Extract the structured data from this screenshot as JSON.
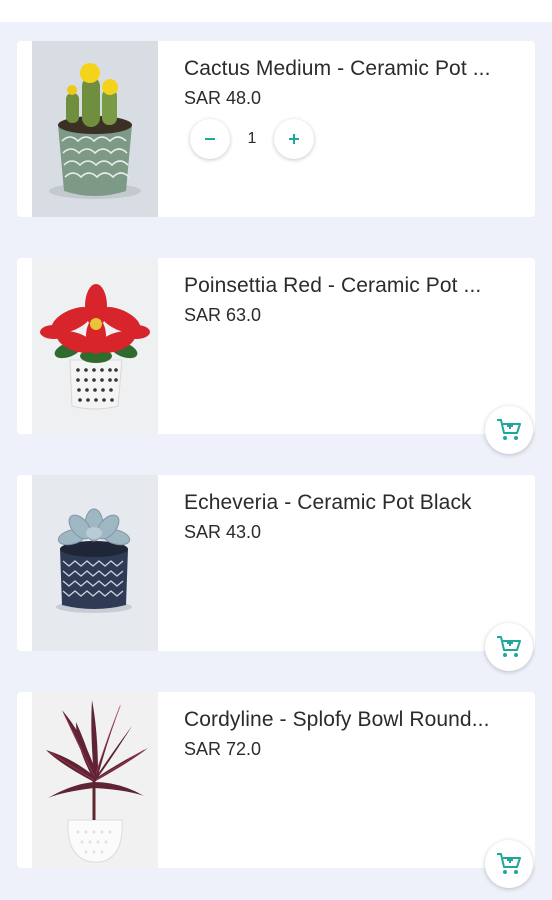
{
  "colors": {
    "background": "#eef1fa",
    "card": "#ffffff",
    "accent": "#1fa89a",
    "text": "#2b2b2b"
  },
  "products": [
    {
      "name": "Cactus Medium - Ceramic Pot ...",
      "price": "SAR 48.0",
      "quantity": "1",
      "image_icon": "cactus-pot-image",
      "in_cart": true
    },
    {
      "name": "Poinsettia Red - Ceramic Pot ...",
      "price": "SAR 63.0",
      "image_icon": "poinsettia-pot-image",
      "in_cart": false
    },
    {
      "name": "Echeveria - Ceramic Pot Black",
      "price": "SAR 43.0",
      "image_icon": "echeveria-pot-image",
      "in_cart": false
    },
    {
      "name": "Cordyline - Splofy Bowl Round...",
      "price": "SAR 72.0",
      "image_icon": "cordyline-bowl-image",
      "in_cart": false
    }
  ],
  "icons": {
    "minus": "minus-icon",
    "plus": "plus-icon",
    "cart": "add-to-cart-icon"
  }
}
